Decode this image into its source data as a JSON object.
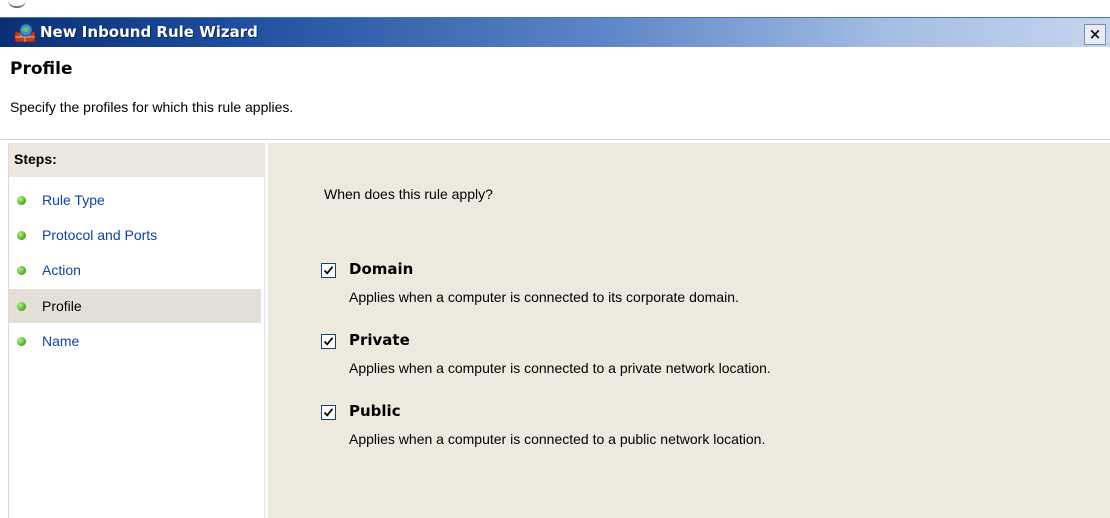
{
  "window": {
    "title": "New Inbound Rule Wizard",
    "close_label": "×",
    "close_icon": "close-icon",
    "app_icon": "firewall-icon"
  },
  "header": {
    "title": "Profile",
    "subtitle": "Specify the profiles for which this rule applies."
  },
  "steps": {
    "header": "Steps:",
    "items": [
      {
        "label": "Rule Type",
        "active": false
      },
      {
        "label": "Protocol and Ports",
        "active": false
      },
      {
        "label": "Action",
        "active": false
      },
      {
        "label": "Profile",
        "active": true
      },
      {
        "label": "Name",
        "active": false
      }
    ]
  },
  "content": {
    "question": "When does this rule apply?",
    "options": [
      {
        "label": "Domain",
        "description": "Applies when a computer is connected to its corporate domain.",
        "checked": true
      },
      {
        "label": "Private",
        "description": "Applies when a computer is connected to a private network location.",
        "checked": true
      },
      {
        "label": "Public",
        "description": "Applies when a computer is connected to a public network location.",
        "checked": true
      }
    ]
  },
  "colors": {
    "title_bar_start": "#0b2f76",
    "title_bar_end": "#c5d5ee",
    "link": "#0b45a6",
    "content_bg": "#ece9df",
    "step_dot": "#5ab82e"
  }
}
